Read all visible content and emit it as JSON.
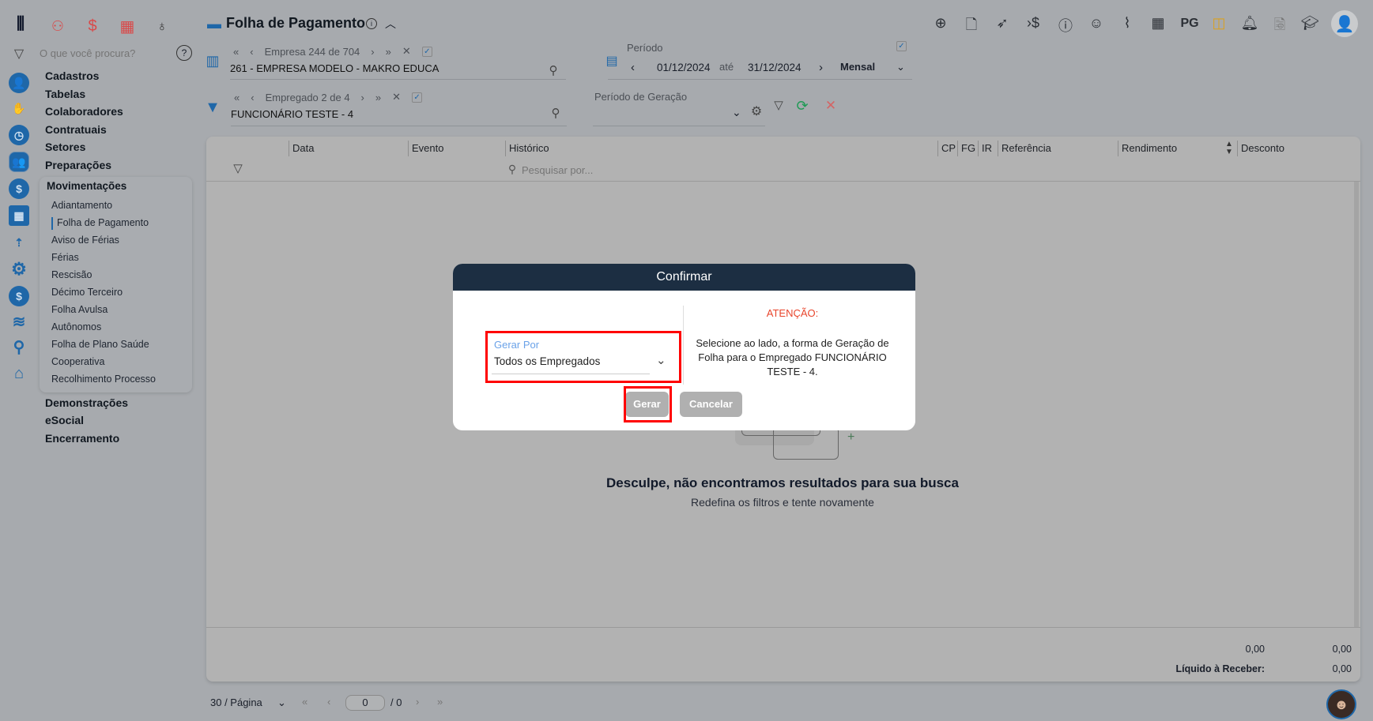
{
  "header": {
    "title": "Folha de Pagamento",
    "top_icons": [
      "plus-circle",
      "document",
      "rocket",
      "arrow-dollar",
      "info",
      "brain",
      "paperclip",
      "calendar",
      "PG",
      "note",
      "bell",
      "search-doc",
      "graduation-cap",
      "avatar"
    ],
    "pg_label": "PG"
  },
  "sidebar": {
    "search_placeholder": "O que você procura?",
    "menu": [
      "Cadastros",
      "Tabelas",
      "Colaboradores",
      "Contratuais",
      "Setores",
      "Preparações"
    ],
    "group": "Movimentações",
    "sub_items": [
      "Adiantamento",
      "Folha de Pagamento",
      "Aviso de Férias",
      "Férias",
      "Rescisão",
      "Décimo Terceiro",
      "Folha Avulsa",
      "Autônomos",
      "Folha de Plano Saúde",
      "Cooperativa",
      "Recolhimento Processo"
    ],
    "active_sub": "Folha de Pagamento",
    "menu_after": [
      "Demonstrações",
      "eSocial",
      "Encerramento"
    ]
  },
  "empresa": {
    "nav": "Empresa 244 de 704",
    "value": "261 - EMPRESA MODELO - MAKRO EDUCA"
  },
  "empregado": {
    "nav": "Empregado 2 de 4",
    "value": "FUNCIONÁRIO TESTE - 4"
  },
  "periodo": {
    "label": "Período",
    "start": "01/12/2024",
    "sep": "até",
    "end": "31/12/2024",
    "mode": "Mensal"
  },
  "geracao": {
    "label": "Período de Geração"
  },
  "table": {
    "columns": [
      "Data",
      "Evento",
      "Histórico",
      "CP",
      "FG",
      "IR",
      "Referência",
      "Rendimento",
      "Desconto"
    ],
    "search_placeholder": "Pesquisar por...",
    "empty_title": "Desculpe, não encontramos resultados para sua busca",
    "empty_sub": "Redefina os filtros e tente novamente",
    "total_rend": "0,00",
    "total_desc": "0,00",
    "liquido_label": "Líquido à Receber:",
    "liquido_value": "0,00"
  },
  "pagination": {
    "per_page": "30 / Página",
    "page": "0",
    "total": "/ 0"
  },
  "modal": {
    "title": "Confirmar",
    "field_label": "Gerar Por",
    "field_value": "Todos os Empregados",
    "attention": "ATENÇÃO:",
    "message": "Selecione ao lado, a forma de Geração de Folha para o Empregado FUNCIONÁRIO TESTE - 4.",
    "confirm": "Gerar",
    "cancel": "Cancelar"
  }
}
